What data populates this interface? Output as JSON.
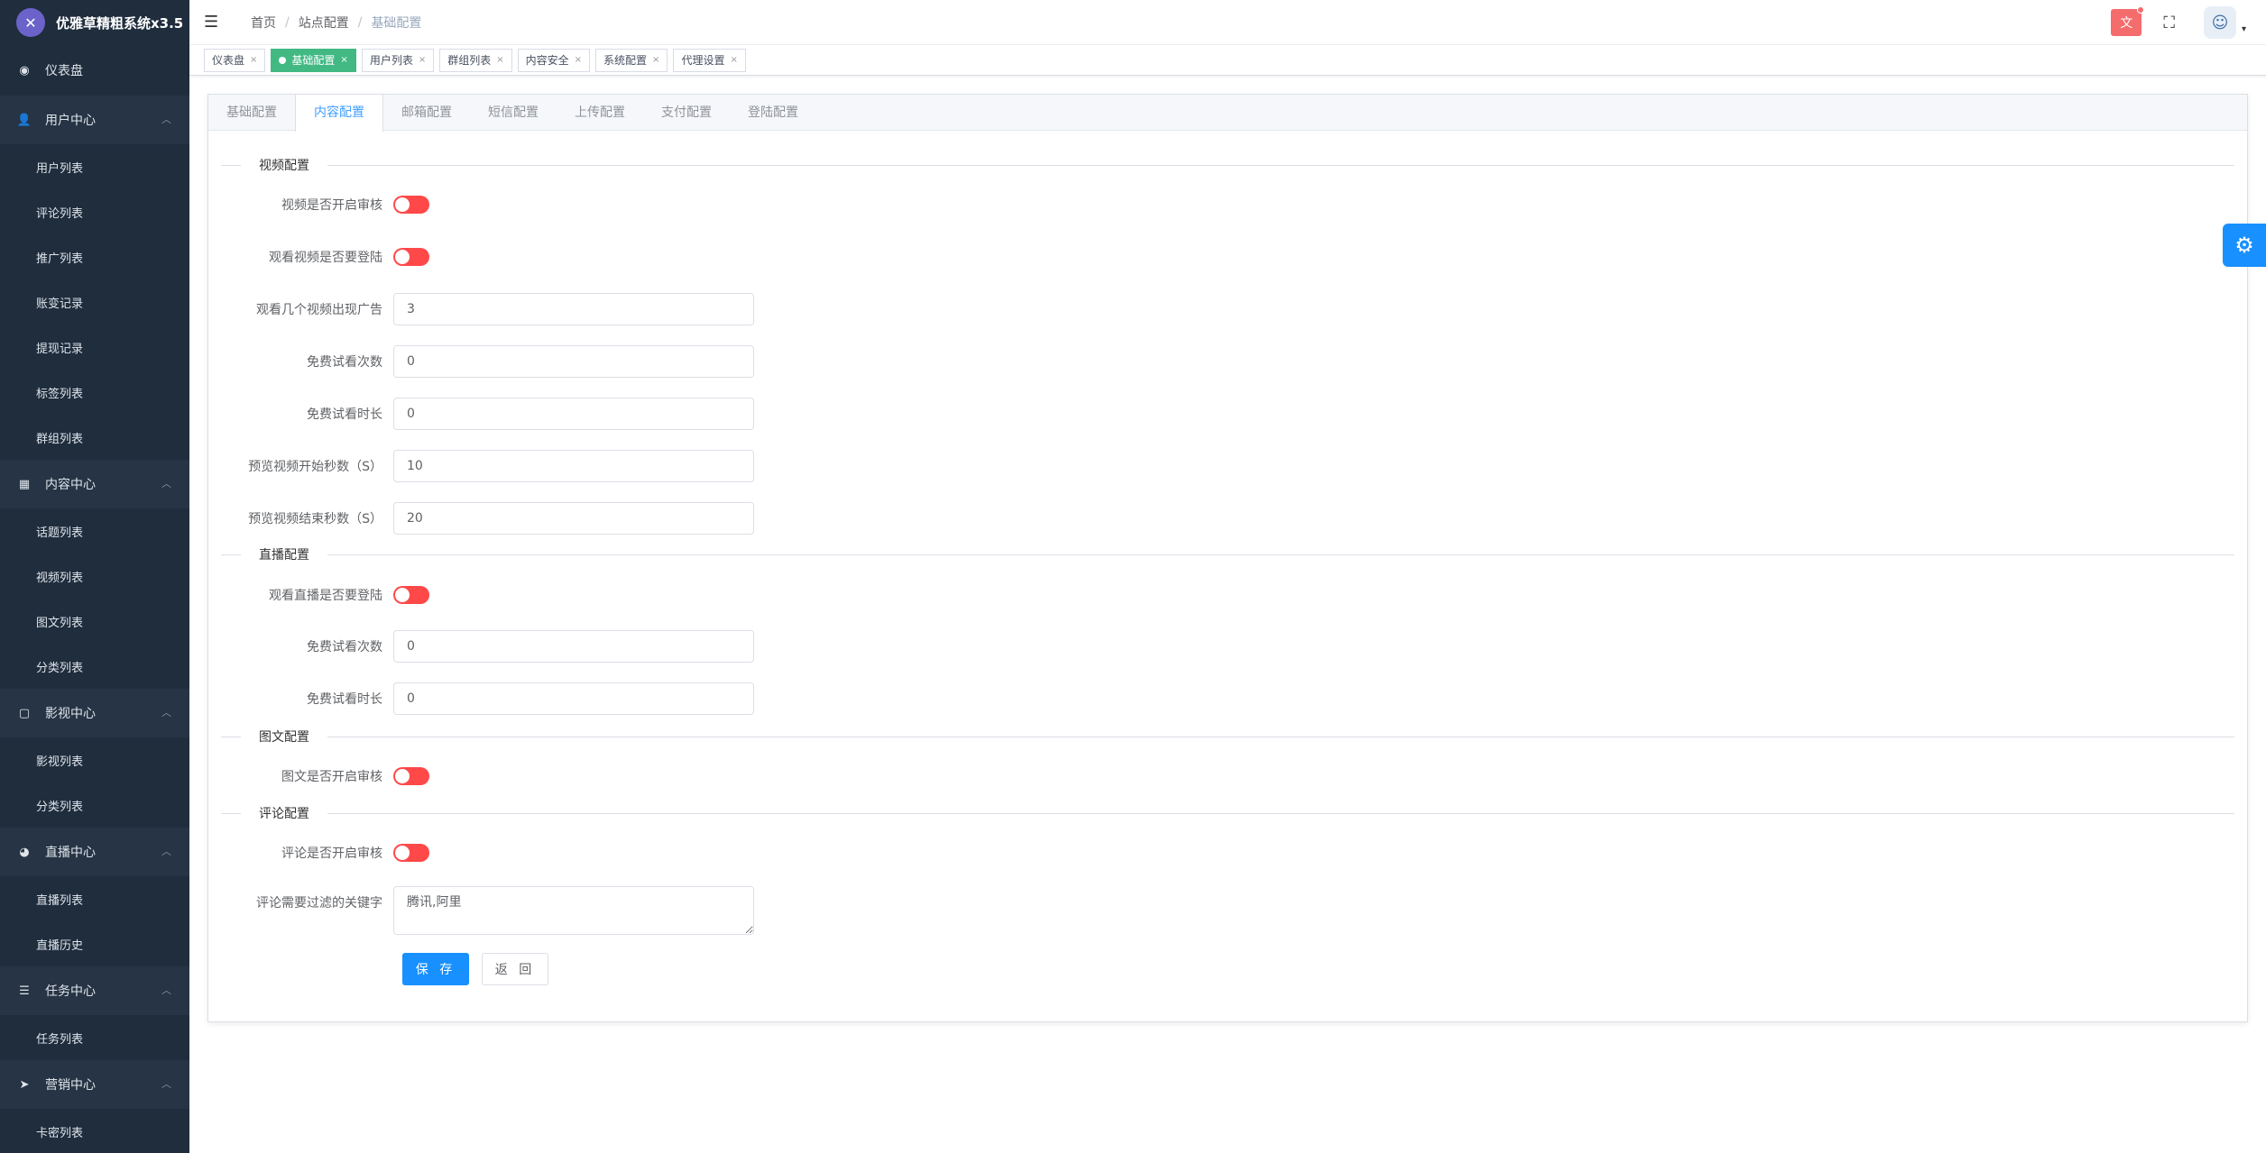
{
  "app": {
    "title": "优雅草精粗系统x3.5",
    "logo_glyph": "✕"
  },
  "sidebar": {
    "dashboard": {
      "icon": "◉",
      "label": "仪表盘"
    },
    "groups": [
      {
        "icon": "👤",
        "label": "用户中心",
        "chevron": "︿",
        "items": [
          "用户列表",
          "评论列表",
          "推广列表",
          "账变记录",
          "提现记录",
          "标签列表",
          "群组列表"
        ]
      },
      {
        "icon": "▦",
        "label": "内容中心",
        "chevron": "︿",
        "items": [
          "话题列表",
          "视频列表",
          "图文列表",
          "分类列表"
        ]
      },
      {
        "icon": "▢",
        "label": "影视中心",
        "chevron": "︿",
        "items": [
          "影视列表",
          "分类列表"
        ]
      },
      {
        "icon": "◕",
        "label": "直播中心",
        "chevron": "︿",
        "items": [
          "直播列表",
          "直播历史"
        ]
      },
      {
        "icon": "☰",
        "label": "任务中心",
        "chevron": "︿",
        "items": [
          "任务列表"
        ]
      },
      {
        "icon": "➤",
        "label": "营销中心",
        "chevron": "︿",
        "items": [
          "卡密列表"
        ]
      }
    ]
  },
  "header": {
    "hamburger": "☰",
    "breadcrumb": [
      "首页",
      "站点配置",
      "基础配置"
    ],
    "breadcrumb_sep": "/",
    "lang_label": "文",
    "fullscreen_icon": "⛶",
    "avatar_icon": "☺",
    "avatar_caret": "▾"
  },
  "tags": [
    {
      "label": "仪表盘",
      "active": false
    },
    {
      "label": "基础配置",
      "active": true
    },
    {
      "label": "用户列表",
      "active": false
    },
    {
      "label": "群组列表",
      "active": false
    },
    {
      "label": "内容安全",
      "active": false
    },
    {
      "label": "系统配置",
      "active": false
    },
    {
      "label": "代理设置",
      "active": false
    }
  ],
  "tag_close": "×",
  "card_tabs": {
    "items": [
      "基础配置",
      "内容配置",
      "邮箱配置",
      "短信配置",
      "上传配置",
      "支付配置",
      "登陆配置"
    ],
    "active_index": 1
  },
  "sections": {
    "video": "视频配置",
    "live": "直播配置",
    "post": "图文配置",
    "comment": "评论配置"
  },
  "form": {
    "video_review": {
      "label": "视频是否开启审核",
      "on": false
    },
    "video_login": {
      "label": "观看视频是否要登陆",
      "on": false
    },
    "ad_after_videos": {
      "label": "观看几个视频出现广告",
      "value": "3"
    },
    "free_trial_count": {
      "label": "免费试看次数",
      "value": "0"
    },
    "free_trial_duration": {
      "label": "免费试看时长",
      "value": "0"
    },
    "preview_start": {
      "label": "预览视频开始秒数（S）",
      "value": "10"
    },
    "preview_end": {
      "label": "预览视频结束秒数（S）",
      "value": "20"
    },
    "live_login": {
      "label": "观看直播是否要登陆",
      "on": false
    },
    "live_free_count": {
      "label": "免费试看次数",
      "value": "0"
    },
    "live_free_duration": {
      "label": "免费试看时长",
      "value": "0"
    },
    "post_review": {
      "label": "图文是否开启审核",
      "on": false
    },
    "comment_review": {
      "label": "评论是否开启审核",
      "on": false
    },
    "comment_keywords": {
      "label": "评论需要过滤的关键字",
      "value": "腾讯,阿里"
    }
  },
  "buttons": {
    "save": "保 存",
    "back": "返 回"
  },
  "float_settings_icon": "⚙",
  "colors": {
    "sidebar_bg": "#1f2d3d",
    "primary": "#1890ff",
    "active_tag": "#42b983",
    "switch_off": "#ff4949"
  }
}
